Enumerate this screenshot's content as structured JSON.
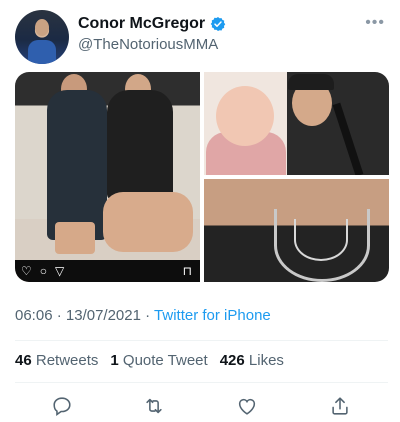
{
  "author": {
    "name": "Conor McGregor",
    "handle": "@TheNotoriousMMA",
    "verified": true,
    "verified_color": "#1d9bf0"
  },
  "menu_icon": "more-horizontal-icon",
  "media": {
    "images": [
      {
        "id": "photo-gym",
        "ig_icons": [
          "heart-icon",
          "comment-icon",
          "share-icon",
          "bookmark-icon"
        ]
      },
      {
        "id": "photo-child"
      },
      {
        "id": "photo-chain"
      }
    ]
  },
  "meta": {
    "time": "06:06",
    "separator": " · ",
    "date": "13/07/2021",
    "source": "Twitter for iPhone",
    "link_color": "#1d9bf0"
  },
  "stats": {
    "retweets_count": "46",
    "retweets_label": "Retweets",
    "quotes_count": "1",
    "quotes_label": "Quote Tweet",
    "likes_count": "426",
    "likes_label": "Likes"
  },
  "actions": [
    "reply-icon",
    "retweet-icon",
    "like-icon",
    "share-icon"
  ]
}
